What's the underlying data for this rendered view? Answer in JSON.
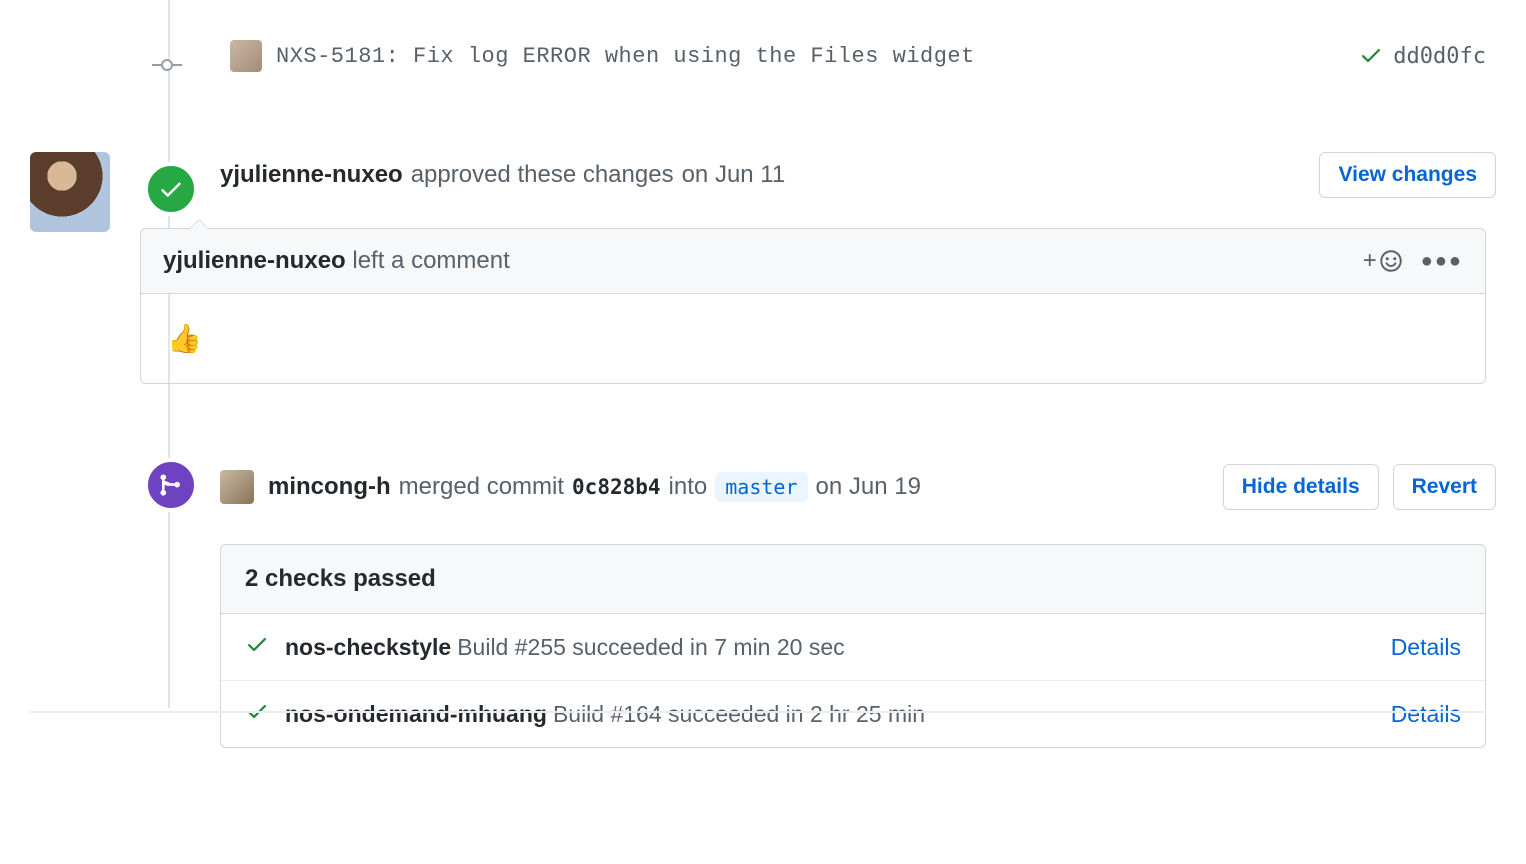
{
  "commit": {
    "message": "NXS-5181: Fix log ERROR when using the Files widget",
    "sha": "dd0d0fc",
    "status": "success"
  },
  "approval": {
    "author": "yjulienne-nuxeo",
    "action": "approved these changes",
    "time": "on Jun 11",
    "view_changes_label": "View changes",
    "comment_action": "left a comment",
    "comment_body": "👍"
  },
  "merge": {
    "author": "mincong-h",
    "action_prefix": "merged commit",
    "commit_sha": "0c828b4",
    "into_label": "into",
    "branch": "master",
    "time": "on Jun 19",
    "hide_details_label": "Hide details",
    "revert_label": "Revert"
  },
  "checks": {
    "title": "2 checks passed",
    "details_label": "Details",
    "items": [
      {
        "name": "nos-checkstyle",
        "desc": "Build #255 succeeded in 7 min 20 sec"
      },
      {
        "name": "nos-ondemand-mhuang",
        "desc": "Build #164 succeeded in 2 hr 25 min"
      }
    ]
  },
  "reaction_plus": "+"
}
